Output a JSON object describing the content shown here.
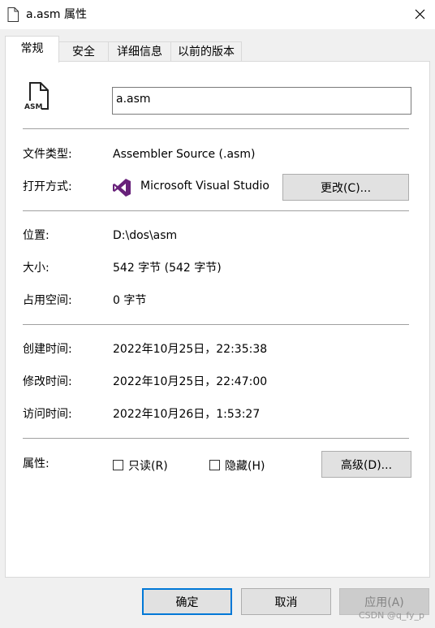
{
  "window": {
    "title": "a.asm 属性",
    "file_icon": "document-icon",
    "close_icon": "close-icon"
  },
  "tabs": [
    {
      "label": "常规",
      "active": true
    },
    {
      "label": "安全"
    },
    {
      "label": "详细信息"
    },
    {
      "label": "以前的版本"
    }
  ],
  "general": {
    "icon": "asm-file-icon",
    "icon_text": "ASM",
    "file_name": "a.asm",
    "file_type_label": "文件类型:",
    "file_type_value": "Assembler Source (.asm)",
    "open_with_label": "打开方式:",
    "open_with_icon": "visual-studio-icon",
    "open_with_value": "Microsoft Visual Studio",
    "change_button": "更改(C)...",
    "location_label": "位置:",
    "location_value": "D:\\dos\\asm",
    "size_label": "大小:",
    "size_value": "542 字节 (542 字节)",
    "size_on_disk_label": "占用空间:",
    "size_on_disk_value": "0 字节",
    "created_label": "创建时间:",
    "created_value": "2022年10月25日，22:35:38",
    "modified_label": "修改时间:",
    "modified_value": "2022年10月25日，22:47:00",
    "accessed_label": "访问时间:",
    "accessed_value": "2022年10月26日，1:53:27",
    "attributes_label": "属性:",
    "readonly_label": "只读(R)",
    "readonly_checked": false,
    "hidden_label": "隐藏(H)",
    "hidden_checked": false,
    "advanced_button": "高级(D)..."
  },
  "footer": {
    "ok": "确定",
    "cancel": "取消",
    "apply": "应用(A)"
  },
  "watermark": "CSDN @q_fy_p",
  "colors": {
    "accent": "#0078d7",
    "vs_purple": "#68217a"
  }
}
